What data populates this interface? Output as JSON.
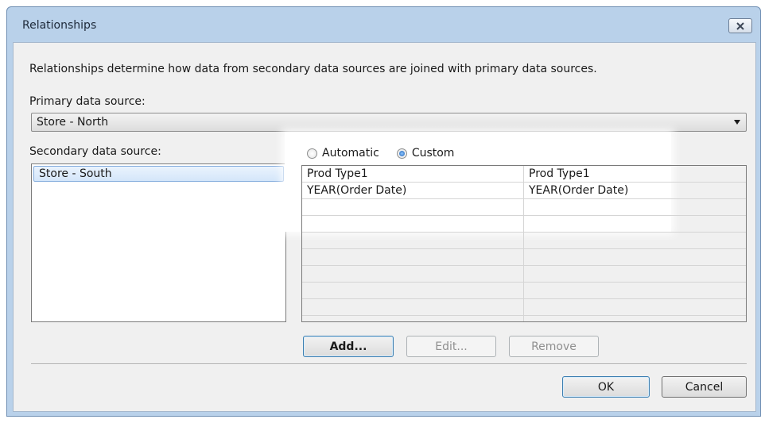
{
  "window": {
    "title": "Relationships",
    "close_icon": "close-icon"
  },
  "description": "Relationships determine how data from secondary data sources are joined with primary data sources.",
  "primary": {
    "label": "Primary data source:",
    "selected": "Store - North"
  },
  "secondary": {
    "label": "Secondary data source:",
    "items": [
      "Store - South"
    ]
  },
  "mode": {
    "automatic_label": "Automatic",
    "custom_label": "Custom",
    "selected": "Custom"
  },
  "mappings": [
    {
      "primary": "Prod Type1",
      "secondary": "Prod Type1"
    },
    {
      "primary": "YEAR(Order Date)",
      "secondary": "YEAR(Order Date)"
    }
  ],
  "buttons": {
    "add": "Add...",
    "edit": "Edit...",
    "remove": "Remove",
    "ok": "OK",
    "cancel": "Cancel"
  },
  "colors": {
    "frame": "#b9d1ea",
    "client": "#f0f0f0",
    "selection": "#d4e6fa"
  }
}
